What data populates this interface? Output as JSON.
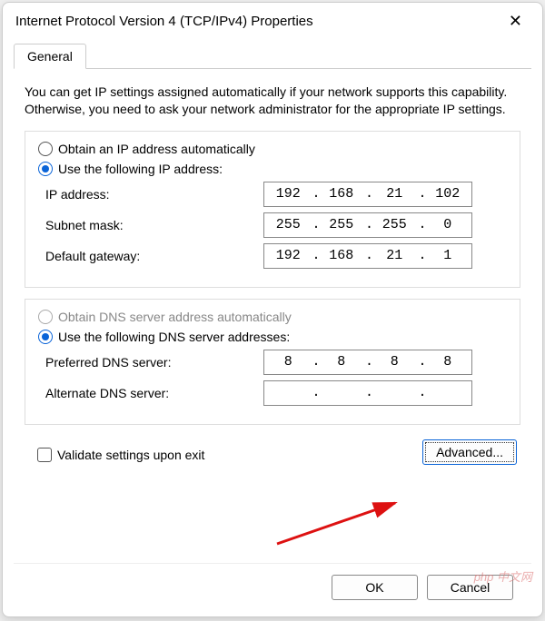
{
  "window": {
    "title": "Internet Protocol Version 4 (TCP/IPv4) Properties"
  },
  "tabs": {
    "general": "General"
  },
  "description": "You can get IP settings assigned automatically if your network supports this capability. Otherwise, you need to ask your network administrator for the appropriate IP settings.",
  "ip_section": {
    "auto_label": "Obtain an IP address automatically",
    "manual_label": "Use the following IP address:",
    "ip_label": "IP address:",
    "ip": [
      "192",
      "168",
      "21",
      "102"
    ],
    "subnet_label": "Subnet mask:",
    "subnet": [
      "255",
      "255",
      "255",
      "0"
    ],
    "gateway_label": "Default gateway:",
    "gateway": [
      "192",
      "168",
      "21",
      "1"
    ]
  },
  "dns_section": {
    "auto_label": "Obtain DNS server address automatically",
    "manual_label": "Use the following DNS server addresses:",
    "preferred_label": "Preferred DNS server:",
    "preferred": [
      "8",
      "8",
      "8",
      "8"
    ],
    "alternate_label": "Alternate DNS server:",
    "alternate": [
      "",
      "",
      "",
      ""
    ]
  },
  "validate_label": "Validate settings upon exit",
  "buttons": {
    "advanced": "Advanced...",
    "ok": "OK",
    "cancel": "Cancel"
  },
  "watermark": "php 中文网"
}
